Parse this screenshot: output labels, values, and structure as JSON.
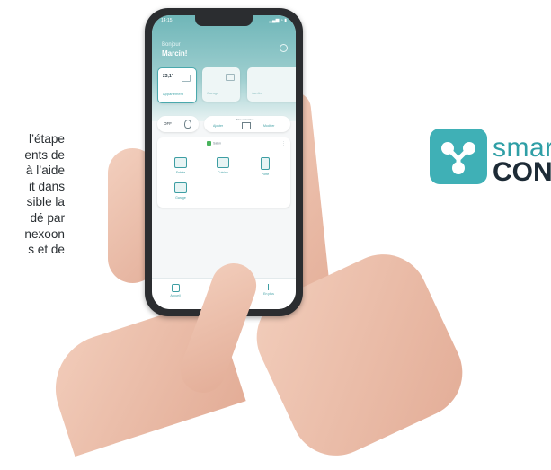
{
  "left_text": {
    "lines": [
      "l’étape",
      "ents de",
      "à l’aide",
      "it dans",
      "sible la",
      "dé par",
      "nexoon",
      "s et de"
    ]
  },
  "logo": {
    "line1": "smar",
    "line2": "CONI",
    "color_mark": "#3fb0b6"
  },
  "phone": {
    "status_time": "14:15",
    "status_icons": "▂▄▆ ◔ ▮",
    "greeting": "Bonjour",
    "user_name": "Marcin!",
    "cards": [
      {
        "temp": "23,1°",
        "label": "Appartement",
        "icon": "home-icon"
      },
      {
        "label": "Garage",
        "icon": "garage-icon"
      },
      {
        "label": "Jardin",
        "icon": "garden-icon"
      }
    ],
    "off_label": "OFF",
    "scenario_title": "Mes scénarios",
    "scenario_a": "Ajouter",
    "scenario_b": "Modifier",
    "room": {
      "tag": "Salon",
      "devices": [
        {
          "label": "Entrée",
          "icon": "window-icon"
        },
        {
          "label": "Cuisine",
          "icon": "window-icon"
        },
        {
          "label": "Porte",
          "icon": "door-icon"
        },
        {
          "label": "Garage",
          "icon": "garage-door-icon"
        }
      ]
    },
    "nav": [
      {
        "label": "Accueil",
        "icon": "home-nav-icon"
      },
      {
        "label": "En plus",
        "icon": "more-nav-icon"
      }
    ],
    "accent": "#3d9ea3"
  }
}
